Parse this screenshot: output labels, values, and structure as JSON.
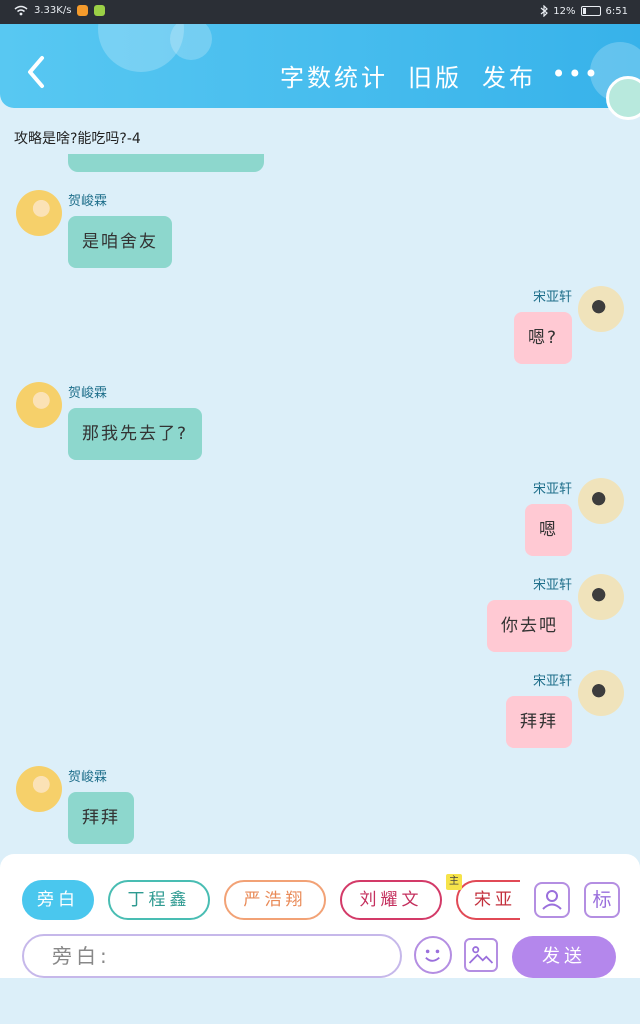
{
  "status_bar": {
    "net_speed": "3.33K/s",
    "battery_pct": "12%",
    "time": "6:51"
  },
  "header": {
    "actions": [
      "字数统计",
      "旧版",
      "发布"
    ],
    "more": "•••"
  },
  "chat": {
    "title": "攻略是啥?能吃吗?-4",
    "messages": [
      {
        "side": "left",
        "name": "贺峻霖",
        "text": "是咱舍友"
      },
      {
        "side": "right",
        "name": "宋亚轩",
        "text": "嗯?"
      },
      {
        "side": "left",
        "name": "贺峻霖",
        "text": "那我先去了?"
      },
      {
        "side": "right",
        "name": "宋亚轩",
        "text": "嗯"
      },
      {
        "side": "right",
        "name": "宋亚轩",
        "text": "你去吧"
      },
      {
        "side": "right",
        "name": "宋亚轩",
        "text": "拜拜"
      },
      {
        "side": "left",
        "name": "贺峻霖",
        "text": "拜拜"
      }
    ]
  },
  "composer": {
    "chips": [
      "旁白",
      "丁程鑫",
      "严浩翔",
      "刘耀文",
      "宋亚"
    ],
    "main_tag": "主",
    "tag_button": "标",
    "input_placeholder": "旁白:",
    "send_label": "发送"
  },
  "colors": {
    "accent": "#37b2ea",
    "left_bubble": "#8dd7cd",
    "right_bubble": "#ffc9d3",
    "send": "#b487ec"
  },
  "icons": [
    "wifi-icon",
    "bluetooth-icon",
    "battery-icon",
    "back-icon",
    "more-icon",
    "person-icon",
    "emoji-icon",
    "image-icon"
  ]
}
